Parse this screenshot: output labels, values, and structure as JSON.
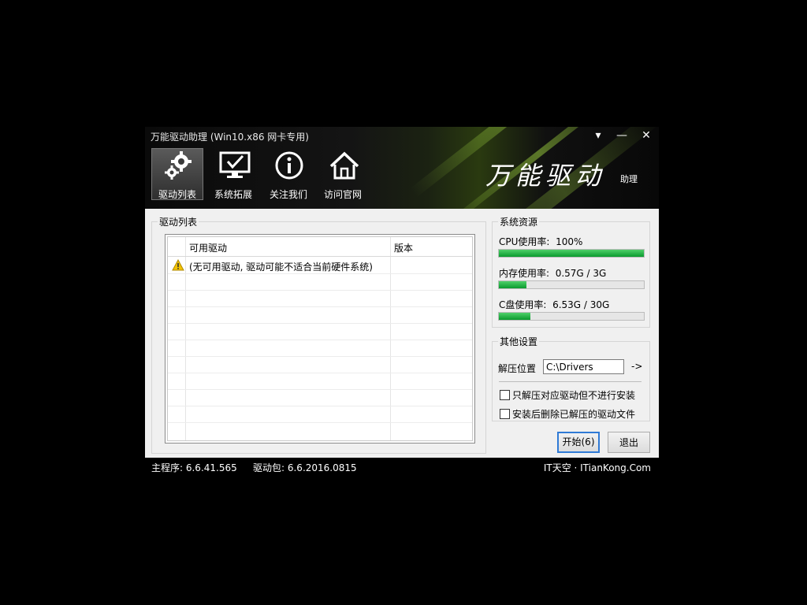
{
  "window": {
    "title": "万能驱动助理 (Win10.x86 网卡专用)",
    "controls": {
      "menu": "▾",
      "minimize": "—",
      "close": "✕"
    }
  },
  "toolbar": {
    "items": [
      {
        "label": "驱动列表",
        "icon": "gear-icon",
        "active": true
      },
      {
        "label": "系统拓展",
        "icon": "monitor-check-icon",
        "active": false
      },
      {
        "label": "关注我们",
        "icon": "info-icon",
        "active": false
      },
      {
        "label": "访问官网",
        "icon": "home-icon",
        "active": false
      }
    ]
  },
  "logo": {
    "text": "万能驱动",
    "sub": "助理"
  },
  "driver_list": {
    "group_title": "驱动列表",
    "columns": [
      "可用驱动",
      "版本"
    ],
    "rows": [
      {
        "icon": "warning-icon",
        "name": "(无可用驱动, 驱动可能不适合当前硬件系统)",
        "version": ""
      }
    ]
  },
  "resources": {
    "group_title": "系统资源",
    "items": [
      {
        "label": "CPU使用率:",
        "value": "100%",
        "fraction": 1.0
      },
      {
        "label": "内存使用率:",
        "value": "0.57G / 3G",
        "fraction": 0.19
      },
      {
        "label": "C盘使用率:",
        "value": "6.53G / 30G",
        "fraction": 0.22
      }
    ]
  },
  "settings": {
    "group_title": "其他设置",
    "extract_label": "解压位置",
    "extract_path": "C:\\Drivers",
    "browse": "->",
    "options": [
      {
        "label": "只解压对应驱动但不进行安装",
        "checked": false
      },
      {
        "label": "安装后删除已解压的驱动文件",
        "checked": false
      }
    ]
  },
  "buttons": {
    "start": "开始(6)",
    "exit": "退出"
  },
  "status": {
    "main_program": "主程序: 6.6.41.565",
    "driver_pack": "驱动包: 6.6.2016.0815",
    "site": "IT天空 · ITianKong.Com"
  },
  "colors": {
    "progress": "#0a9a2e",
    "accent": "#2f7ad6"
  }
}
